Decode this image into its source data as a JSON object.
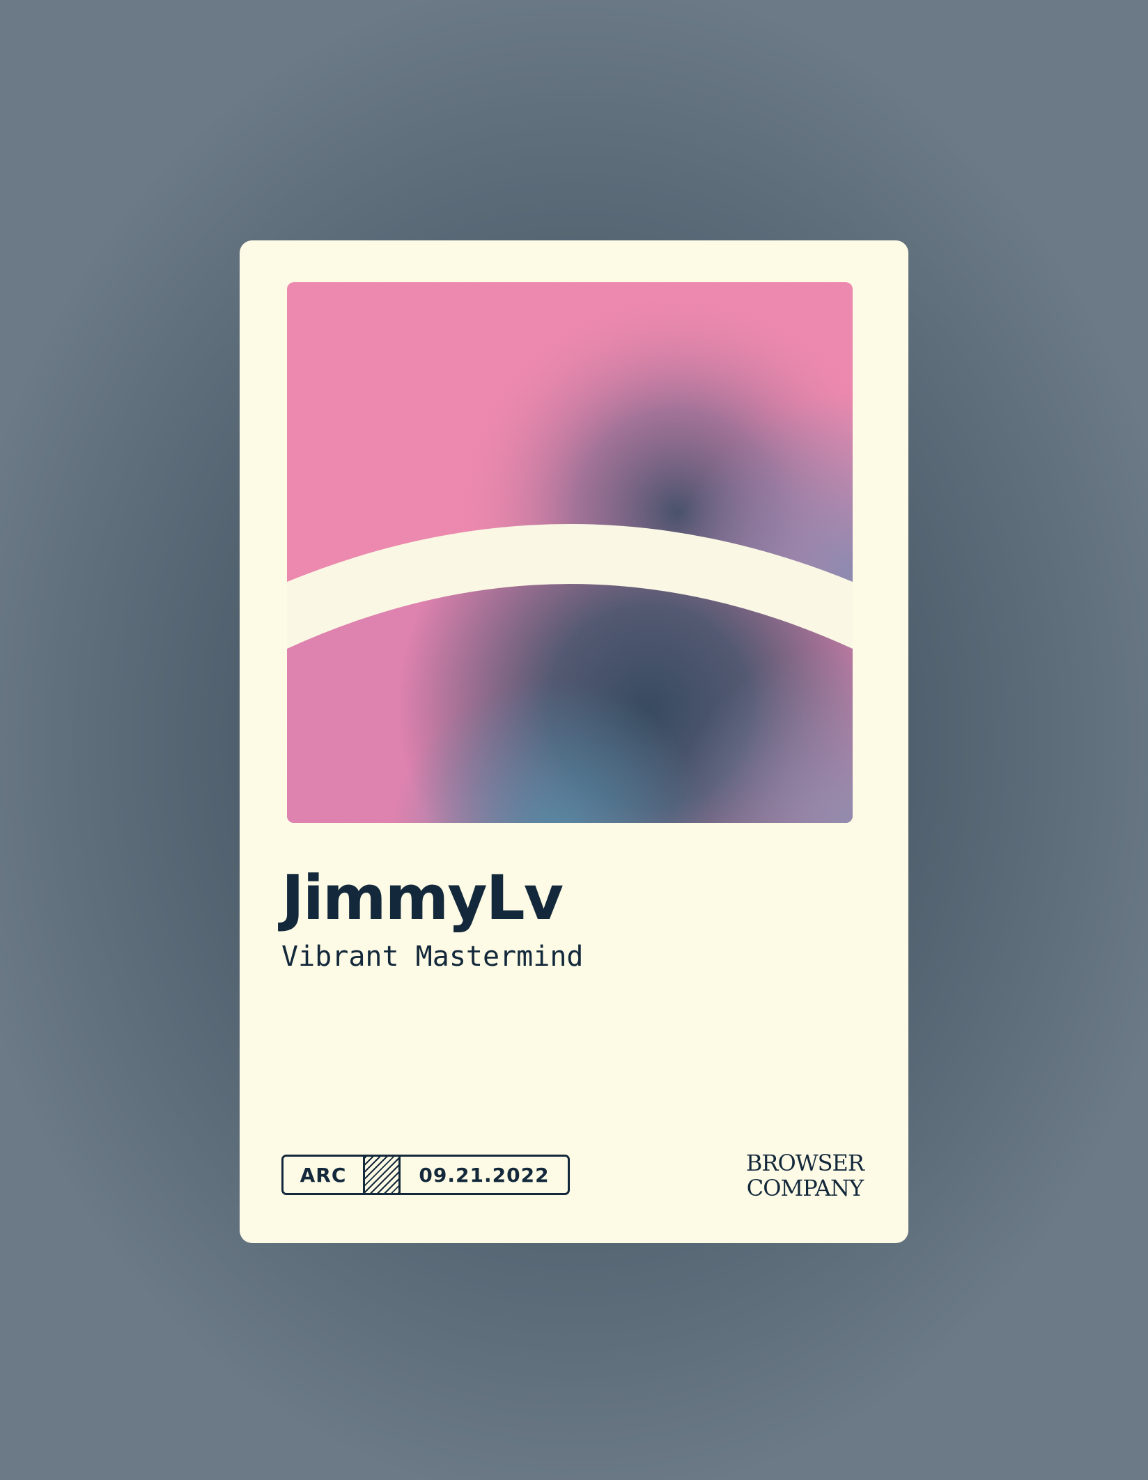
{
  "card": {
    "name": "JimmyLv",
    "subtitle": "Vibrant Mastermind",
    "tag": {
      "left": "ARC",
      "date": "09.21.2022"
    },
    "logo": {
      "line1": "BROWSER",
      "line2": "COMPANY"
    }
  },
  "colors": {
    "card_background": "#fdfbe6",
    "text": "#13283a",
    "art_pink": "#ef86ad",
    "art_navy": "#34495d",
    "art_teal": "#4a8aa6",
    "art_lavender": "#8c8aac"
  }
}
